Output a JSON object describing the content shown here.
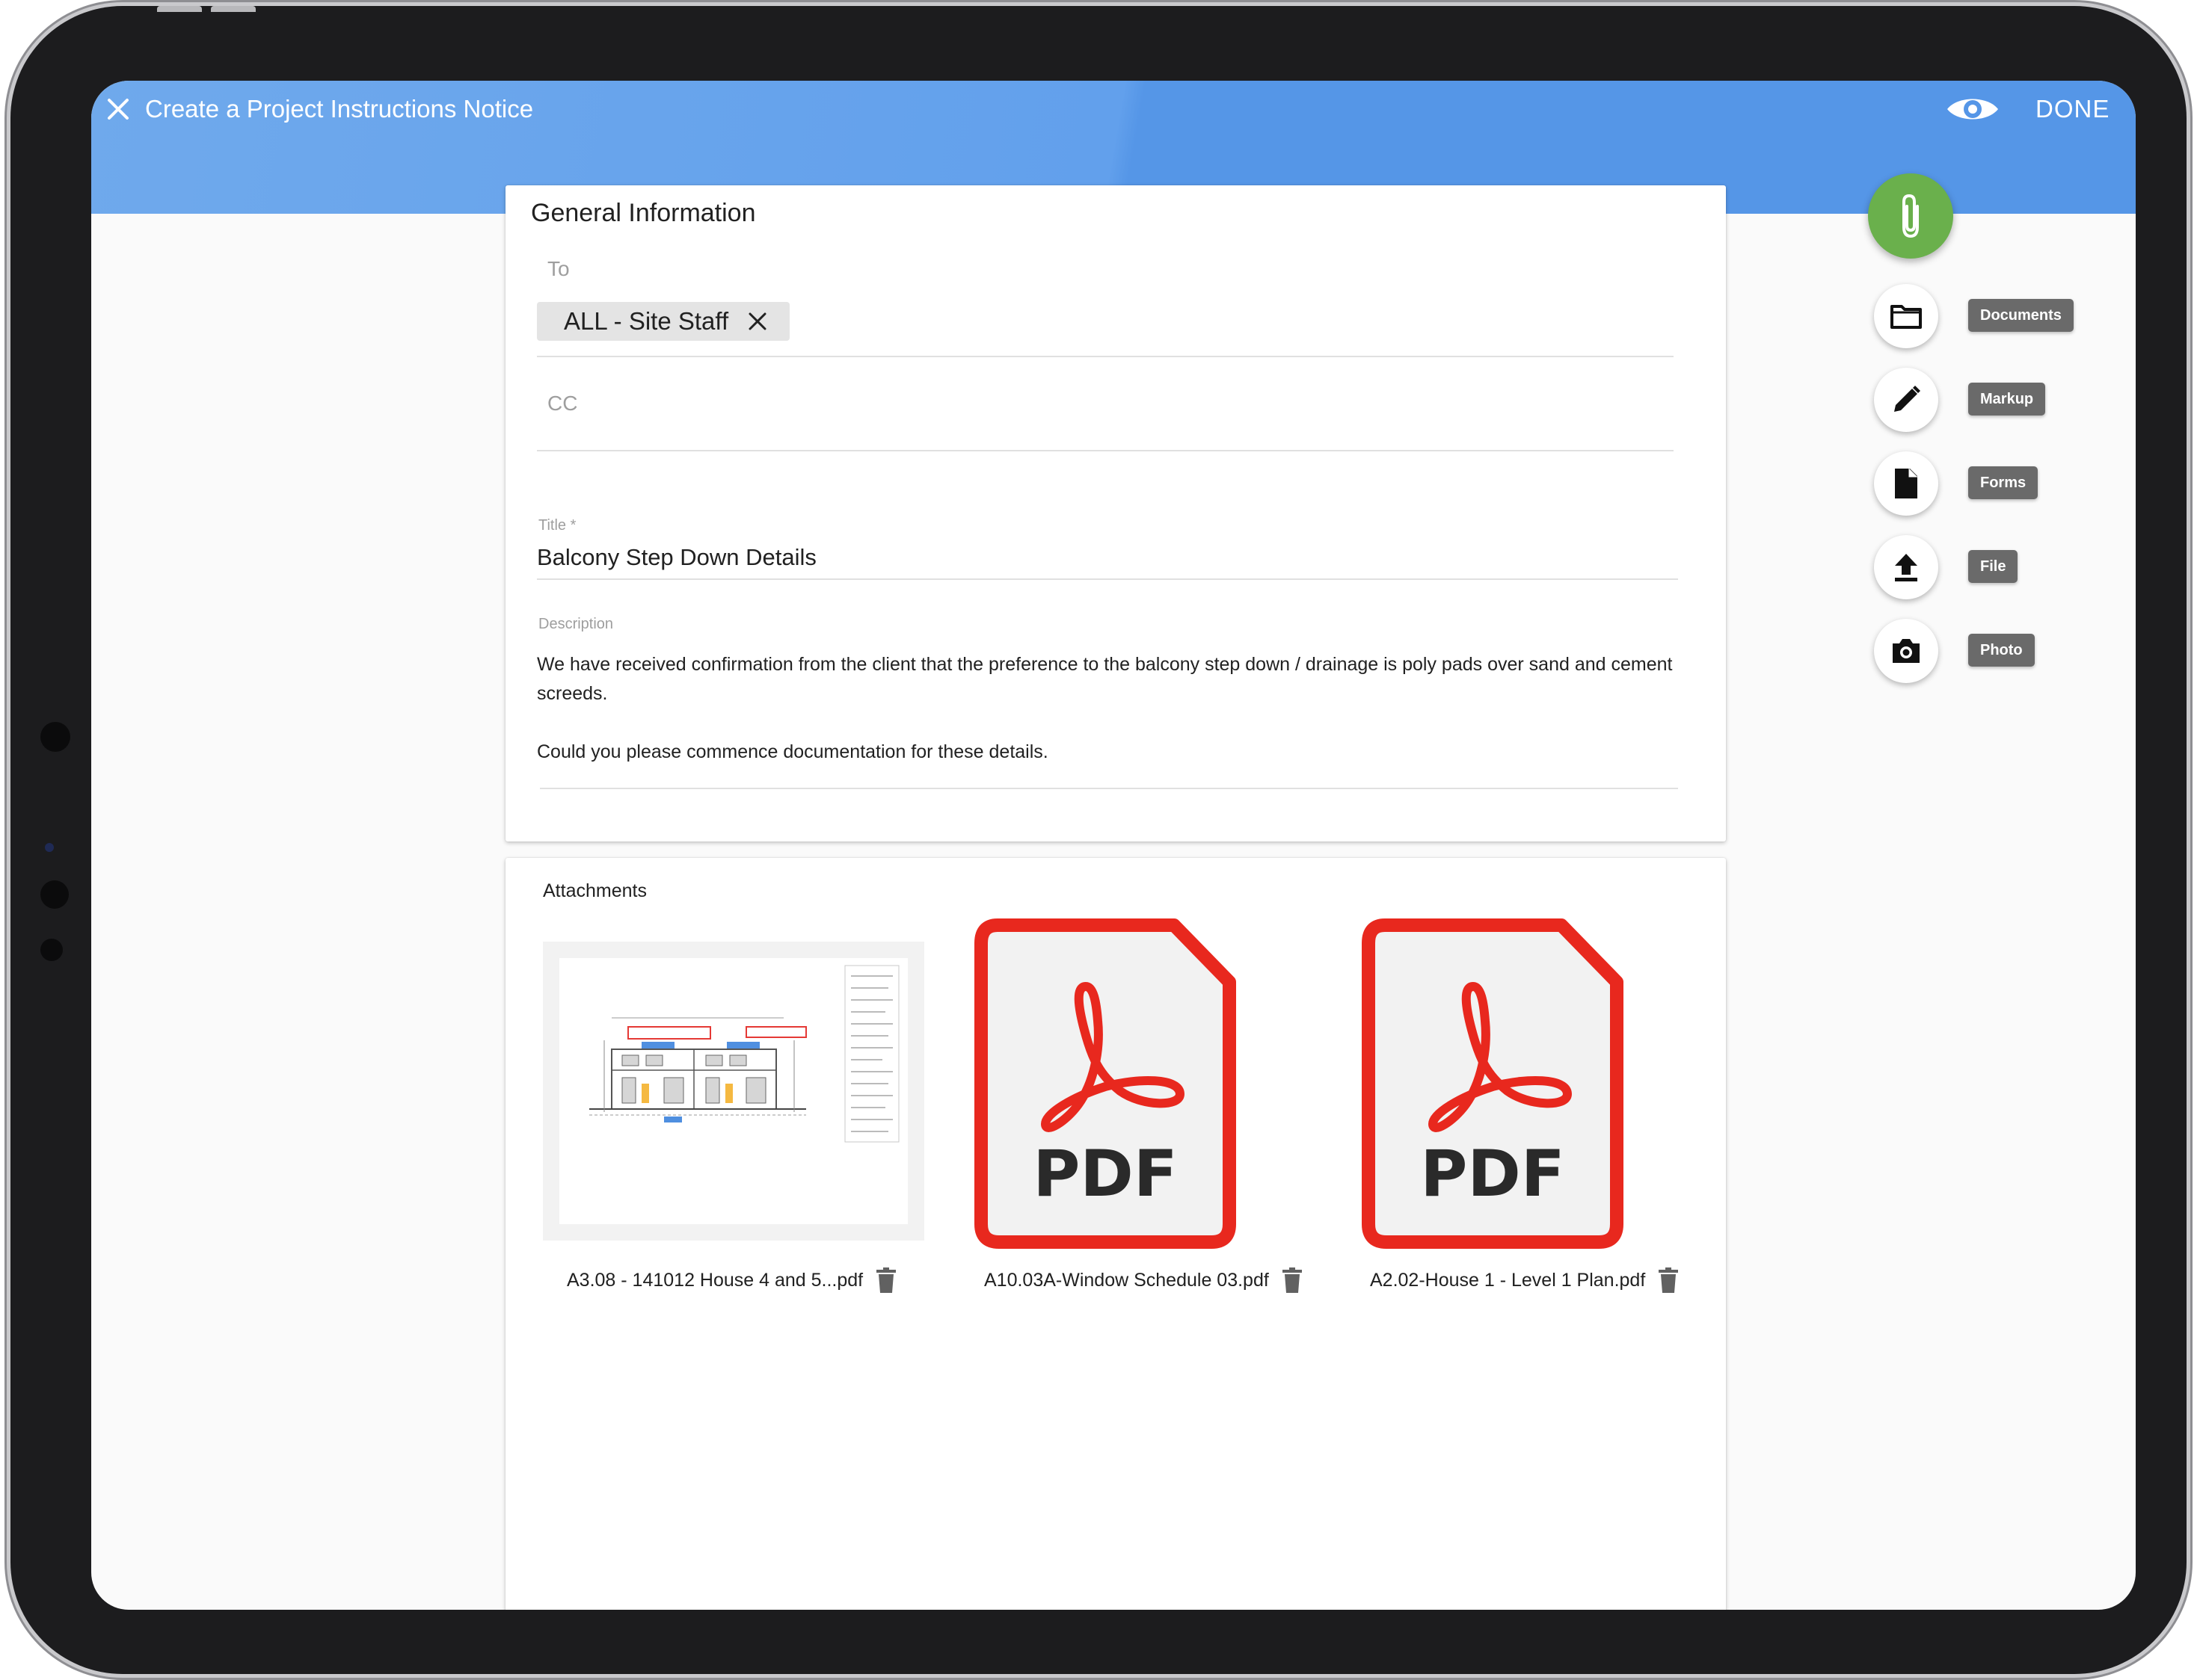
{
  "appbar": {
    "title": "Create a Project Instructions Notice",
    "done_label": "DONE",
    "icons": {
      "close": "close-icon",
      "preview": "eye-icon"
    }
  },
  "general": {
    "heading": "General Information",
    "to_label": "To",
    "to_chips": [
      "ALL - Site Staff"
    ],
    "cc_label": "CC",
    "title_label": "Title *",
    "title_value": "Balcony Step Down Details",
    "description_label": "Description",
    "description_paragraphs": [
      "We have received confirmation from the client that the preference to the balcony step down / drainage is poly pads over sand and cement screeds.",
      "Could you please commence documentation for these details."
    ]
  },
  "attachments": {
    "heading": "Attachments",
    "items": [
      {
        "name": "A3.08 - 141012 House 4 and 5...pdf",
        "preview": "drawing-thumbnail"
      },
      {
        "name": "A10.03A-Window Schedule 03.pdf",
        "preview": "pdf-icon",
        "icon_text": "PDF"
      },
      {
        "name": "A2.02-House 1 - Level 1 Plan.pdf",
        "preview": "pdf-icon",
        "icon_text": "PDF"
      }
    ]
  },
  "speed_dial": {
    "main_icon": "paperclip-icon",
    "actions": [
      {
        "label": "Documents",
        "icon": "folder-icon"
      },
      {
        "label": "Markup",
        "icon": "pencil-icon"
      },
      {
        "label": "Forms",
        "icon": "document-icon"
      },
      {
        "label": "File",
        "icon": "upload-icon"
      },
      {
        "label": "Photo",
        "icon": "camera-icon"
      }
    ]
  },
  "colors": {
    "appbar": "#5596e7",
    "fab": "#6ab04c",
    "pdf_red": "#e8281e",
    "dial_label": "#6a6a6a"
  }
}
